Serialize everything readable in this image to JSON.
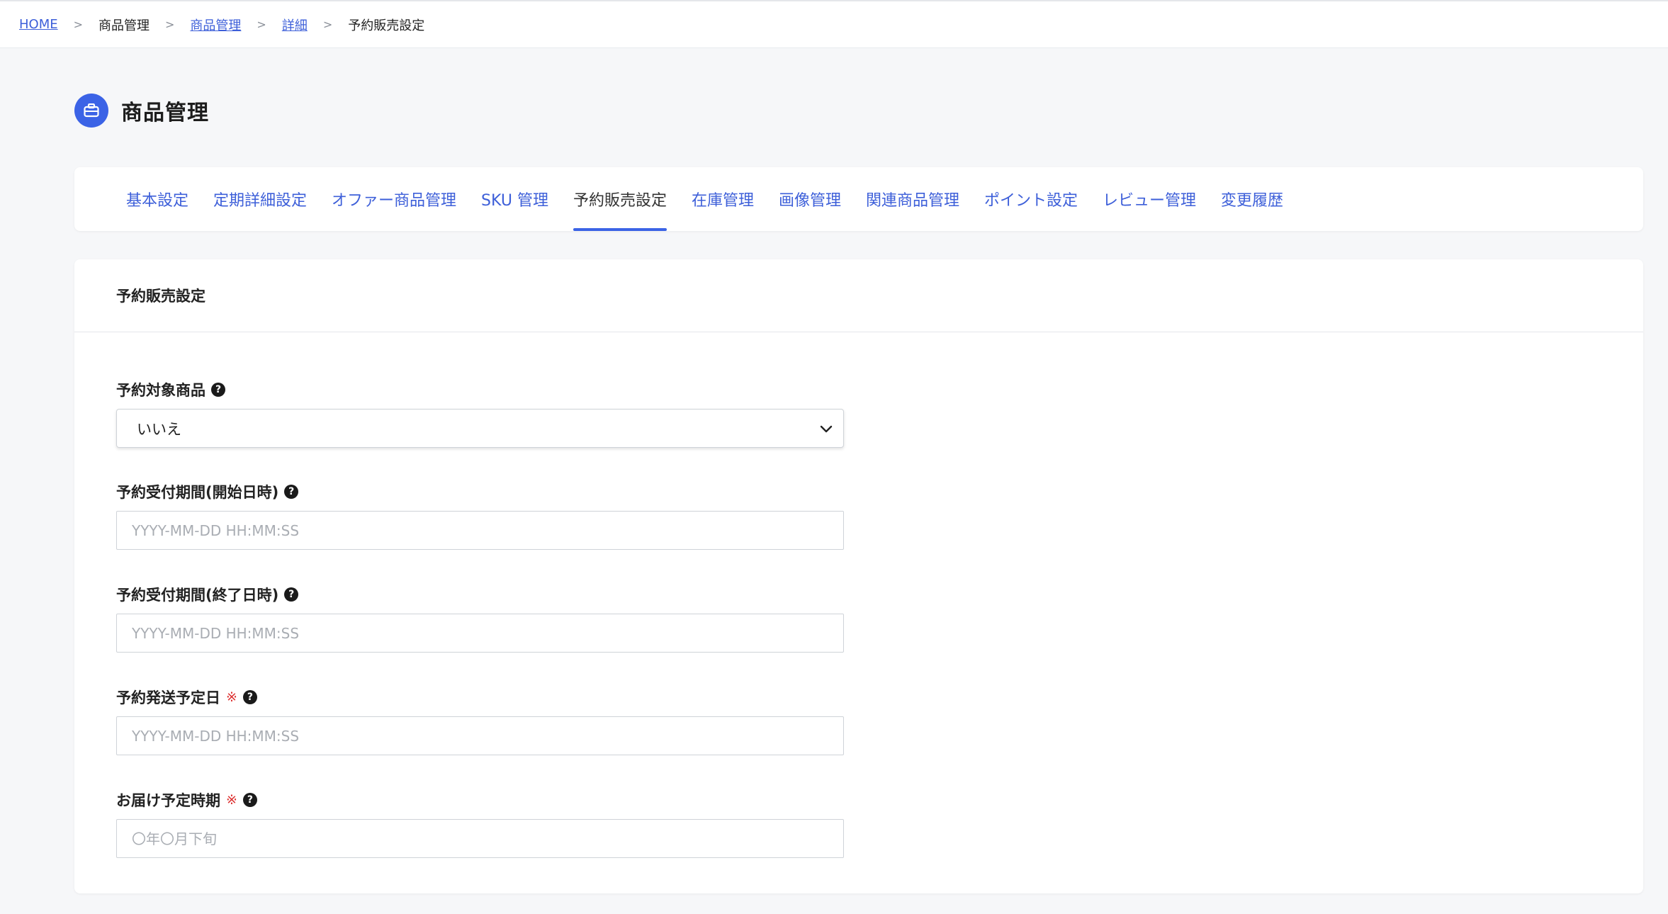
{
  "breadcrumb": [
    {
      "label": "HOME",
      "link": true
    },
    {
      "label": "商品管理",
      "link": false
    },
    {
      "label": "商品管理",
      "link": true
    },
    {
      "label": "詳細",
      "link": true
    },
    {
      "label": "予約販売設定",
      "link": false
    }
  ],
  "breadcrumb_sep": ">",
  "page": {
    "title": "商品管理",
    "icon": "briefcase-icon",
    "accent_color": "#3b63e6"
  },
  "tabs": [
    {
      "label": "基本設定",
      "active": false
    },
    {
      "label": "定期詳細設定",
      "active": false
    },
    {
      "label": "オファー商品管理",
      "active": false
    },
    {
      "label": "SKU 管理",
      "active": false
    },
    {
      "label": "予約販売設定",
      "active": true
    },
    {
      "label": "在庫管理",
      "active": false
    },
    {
      "label": "画像管理",
      "active": false
    },
    {
      "label": "関連商品管理",
      "active": false
    },
    {
      "label": "ポイント設定",
      "active": false
    },
    {
      "label": "レビュー管理",
      "active": false
    },
    {
      "label": "変更履歴",
      "active": false
    }
  ],
  "form": {
    "section_title": "予約販売設定",
    "required_mark": "※",
    "help_glyph": "?",
    "fields": {
      "reservation_target": {
        "label": "予約対象商品",
        "value": "いいえ"
      },
      "accept_start": {
        "label": "予約受付期間(開始日時)",
        "placeholder": "YYYY-MM-DD HH:MM:SS",
        "value": ""
      },
      "accept_end": {
        "label": "予約受付期間(終了日時)",
        "placeholder": "YYYY-MM-DD HH:MM:SS",
        "value": ""
      },
      "ship_date": {
        "label": "予約発送予定日",
        "placeholder": "YYYY-MM-DD HH:MM:SS",
        "value": ""
      },
      "delivery_period": {
        "label": "お届け予定時期",
        "placeholder": "〇年〇月下旬",
        "value": ""
      }
    }
  }
}
